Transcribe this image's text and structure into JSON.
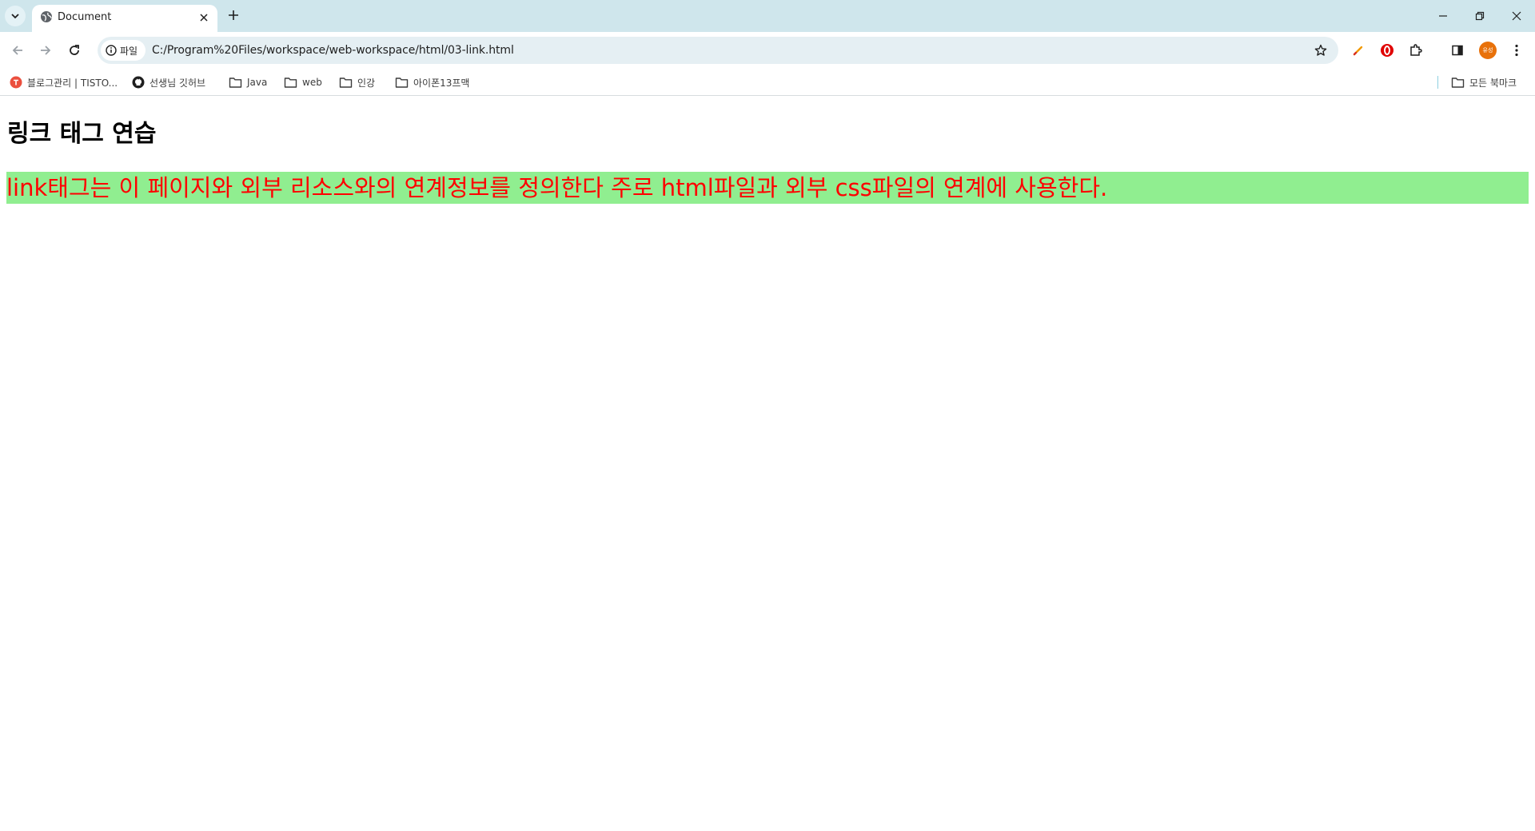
{
  "browser": {
    "tab": {
      "title": "Document"
    },
    "address": {
      "chip_label": "파일",
      "url": "C:/Program%20Files/workspace/web-workspace/html/03-link.html"
    },
    "profile": {
      "initials": "유성"
    },
    "bookmarks": [
      {
        "label": "블로그관리 | TISTO...",
        "icon": "tistory-icon"
      },
      {
        "label": "선생님 깃허브",
        "icon": "github-icon"
      },
      {
        "label": "Java",
        "icon": "folder-icon"
      },
      {
        "label": "web",
        "icon": "folder-icon"
      },
      {
        "label": "인강",
        "icon": "folder-icon"
      },
      {
        "label": "아이폰13프맥",
        "icon": "folder-icon"
      }
    ],
    "all_bookmarks_label": "모든 북마크",
    "colors": {
      "tabstrip": "#cfe6ec",
      "omnibox": "#e5eff3",
      "avatar": "#e8710a"
    }
  },
  "page": {
    "heading": "링크 태그 연습",
    "paragraph": "link태그는 이 페이지와 외부 리소스와의 연계정보를 정의한다 주로 html파일과 외부 css파일의 연계에 사용한다.",
    "colors": {
      "paragraph_bg": "#90ee90",
      "paragraph_text": "#ff0000"
    }
  }
}
